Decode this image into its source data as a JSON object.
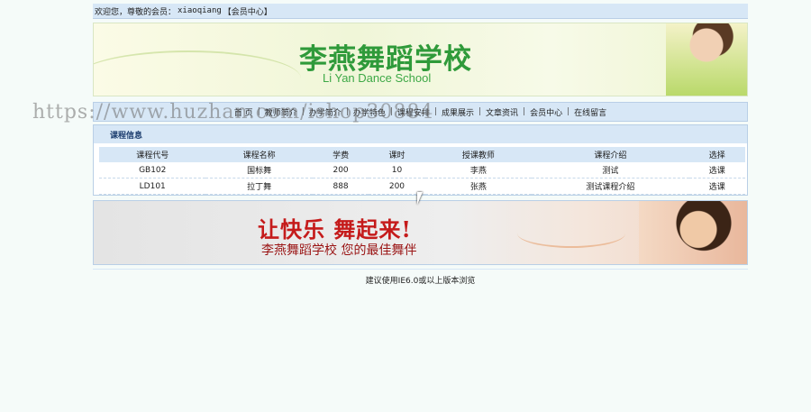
{
  "topbar": {
    "welcome": "欢迎您，尊敬的会员：",
    "username": "xiaoqiang",
    "member_center": "【会员中心】"
  },
  "banner": {
    "title": "李燕舞蹈学校",
    "subtitle": "Li Yan Dance School"
  },
  "nav": {
    "items": [
      {
        "label": "首 页"
      },
      {
        "label": "教师简介"
      },
      {
        "label": "办学简介"
      },
      {
        "label": "办学特色"
      },
      {
        "label": "课程安排"
      },
      {
        "label": "成果展示"
      },
      {
        "label": "文章资讯"
      },
      {
        "label": "会员中心"
      },
      {
        "label": "在线留言"
      }
    ],
    "separator": "|"
  },
  "panel": {
    "title": "课程信息",
    "columns": [
      "课程代号",
      "课程名称",
      "学费",
      "课时",
      "授课教师",
      "课程介绍",
      "选择"
    ],
    "rows": [
      {
        "code": "GB102",
        "name": "国标舞",
        "fee": "200",
        "hours": "10",
        "teacher": "李燕",
        "intro": "测试",
        "action": "选课"
      },
      {
        "code": "LD101",
        "name": "拉丁舞",
        "fee": "888",
        "hours": "200",
        "teacher": "张燕",
        "intro": "测试课程介绍",
        "action": "选课"
      }
    ]
  },
  "ad": {
    "slogan": "让快乐 舞起来!",
    "tagline": "李燕舞蹈学校 您的最佳舞伴"
  },
  "footer": {
    "note": "建议使用IE6.0或以上版本浏览"
  },
  "watermark": {
    "text": "https://www.huzhan.com/ishop30884"
  }
}
